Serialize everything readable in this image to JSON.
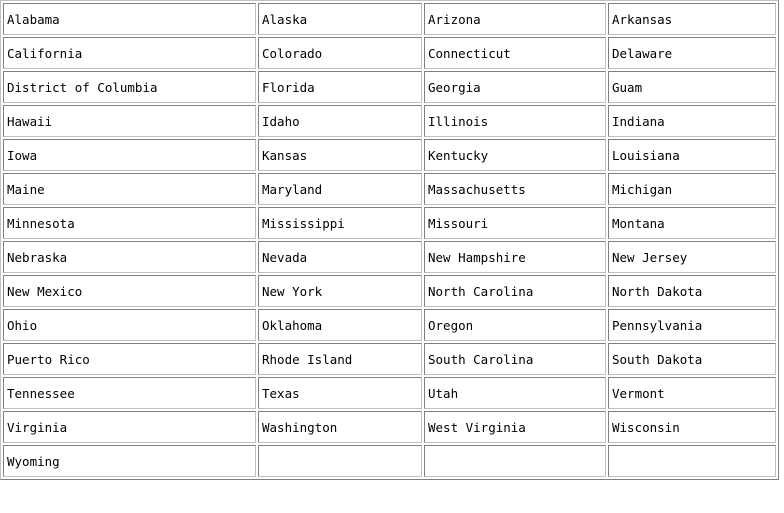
{
  "table": {
    "columns": 4,
    "rows": 14,
    "border_color": "#808080",
    "text_color": "#000000",
    "background_color": "#ffffff",
    "cells": [
      [
        "Alabama",
        "Alaska",
        "Arizona",
        "Arkansas"
      ],
      [
        "California",
        "Colorado",
        "Connecticut",
        "Delaware"
      ],
      [
        "District of Columbia",
        "Florida",
        "Georgia",
        "Guam"
      ],
      [
        "Hawaii",
        "Idaho",
        "Illinois",
        "Indiana"
      ],
      [
        "Iowa",
        "Kansas",
        "Kentucky",
        "Louisiana"
      ],
      [
        "Maine",
        "Maryland",
        "Massachusetts",
        "Michigan"
      ],
      [
        "Minnesota",
        "Mississippi",
        "Missouri",
        "Montana"
      ],
      [
        "Nebraska",
        "Nevada",
        "New Hampshire",
        "New Jersey"
      ],
      [
        "New Mexico",
        "New York",
        "North Carolina",
        "North Dakota"
      ],
      [
        "Ohio",
        "Oklahoma",
        "Oregon",
        "Pennsylvania"
      ],
      [
        "Puerto Rico",
        "Rhode Island",
        "South Carolina",
        "South Dakota"
      ],
      [
        "Tennessee",
        "Texas",
        "Utah",
        "Vermont"
      ],
      [
        "Virginia",
        "Washington",
        "West Virginia",
        "Wisconsin"
      ],
      [
        "Wyoming",
        "",
        "",
        ""
      ]
    ]
  }
}
